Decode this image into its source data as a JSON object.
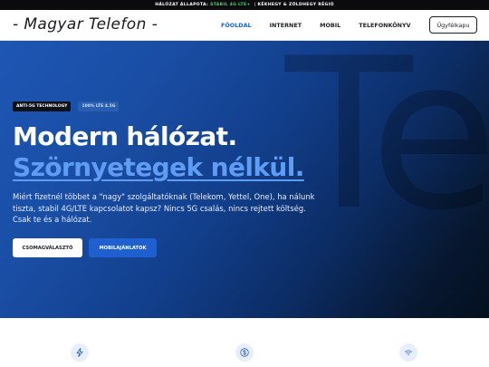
{
  "status_bar": {
    "label": "HÁLÓZAT ÁLLAPOTA:",
    "status": "STABIL 4G LTE+",
    "separator": "|",
    "region": "KÉKHEGY & ZÖLDHEGY RÉGIÓ"
  },
  "header": {
    "logo": "- Magyar Telefon -",
    "nav": [
      "FŐOLDAL",
      "INTERNET",
      "MOBIL",
      "TELEFONKÖNYV"
    ],
    "active_nav": "FŐOLDAL",
    "account_button": "Ügyfélkapu"
  },
  "hero": {
    "badges": [
      "ANTI-5G TECHNOLOGY",
      "100% LTE 4.5G"
    ],
    "headline_line1": "Modern hálózat.",
    "headline_line2": "Szörnyetegek nélkül.",
    "description": "Miért fizetnél többet a \"nagy\" szolgáltatóknak (Telekom, Yettel, One), ha nálunk tiszta, stabil 4G/LTE kapcsolatot kapsz? Nincs 5G csalás, nincs rejtett költség. Csak te és a hálózat.",
    "primary_button": "CSOMAGVÁLASZTÓ",
    "secondary_button": "MOBILAJÁNLATOK",
    "watermark": "Te"
  },
  "features": {
    "icons": [
      "lightning-icon",
      "dollar-icon",
      "wifi-icon"
    ]
  },
  "colors": {
    "accent": "#1f63cf",
    "status_ok": "#3fd46a",
    "headline_accent": "#5f9df4"
  }
}
